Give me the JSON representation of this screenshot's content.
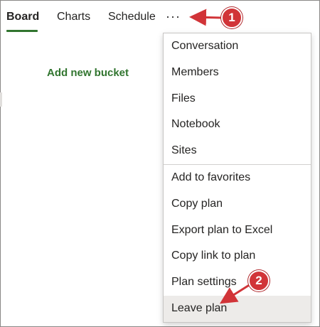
{
  "tabs": [
    {
      "label": "Board",
      "active": true
    },
    {
      "label": "Charts",
      "active": false
    },
    {
      "label": "Schedule",
      "active": false
    }
  ],
  "more_label": "···",
  "add_bucket_label": "Add new bucket",
  "menu": {
    "groups": [
      [
        "Conversation",
        "Members",
        "Files",
        "Notebook",
        "Sites"
      ],
      [
        "Add to favorites",
        "Copy plan",
        "Export plan to Excel",
        "Copy link to plan",
        "Plan settings",
        "Leave plan"
      ]
    ],
    "hovered_item": "Leave plan"
  },
  "callouts": [
    {
      "number": "1",
      "target": "more-options"
    },
    {
      "number": "2",
      "target": "leave-plan"
    }
  ],
  "colors": {
    "accent": "#31752f",
    "callout": "#d13438",
    "hover": "#edebe9"
  }
}
